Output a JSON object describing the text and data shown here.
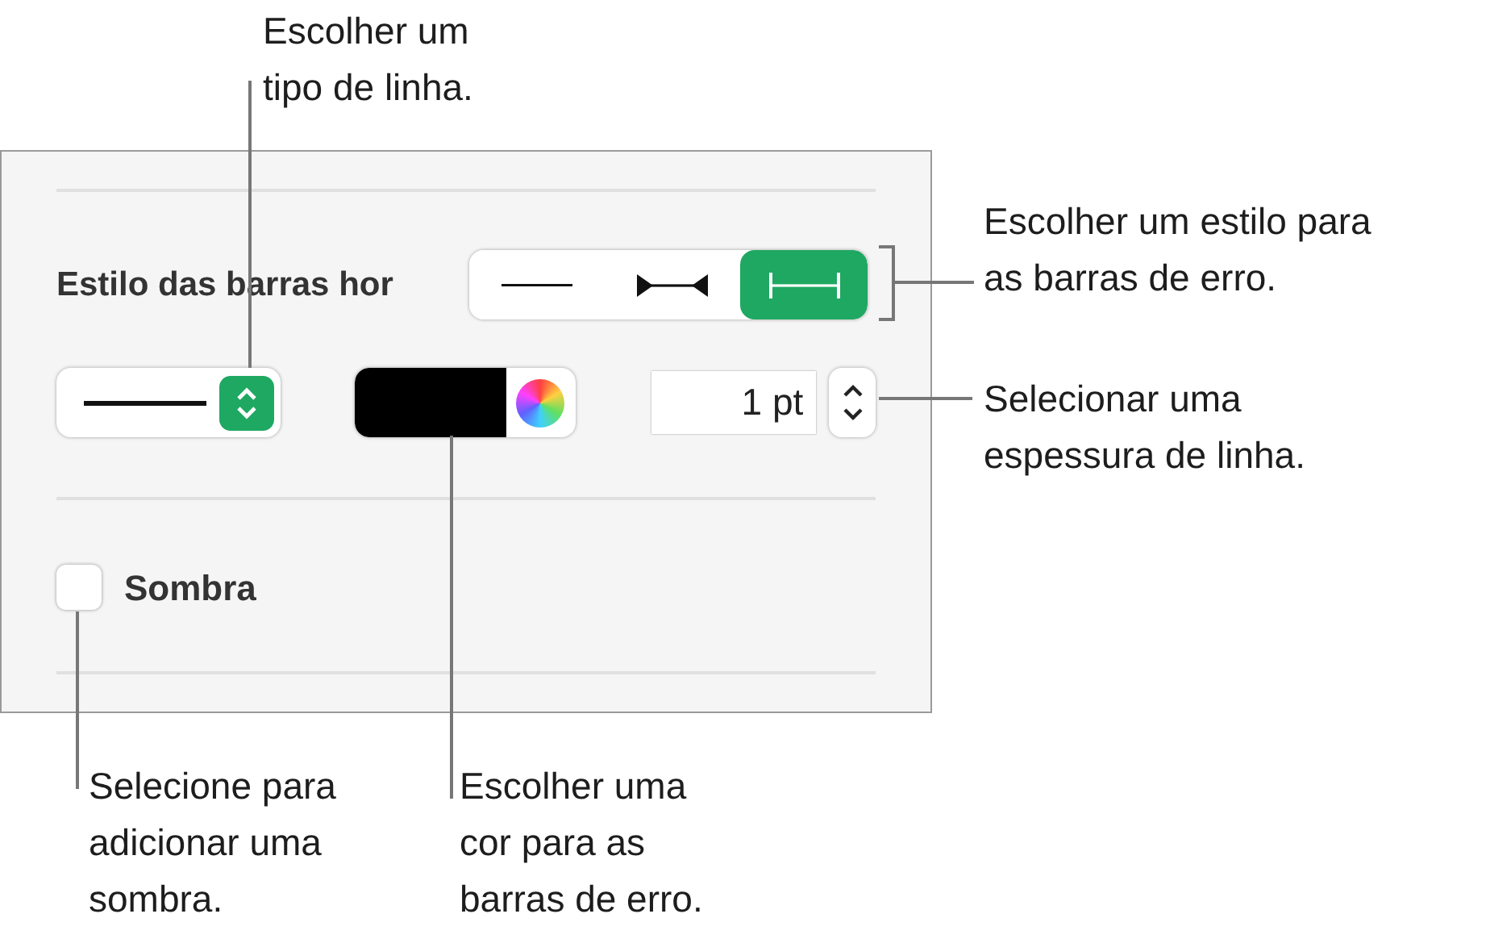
{
  "panel": {
    "style_label": "Estilo das barras hor",
    "segments": [
      {
        "kind": "plain",
        "selected": false
      },
      {
        "kind": "arrows",
        "selected": false
      },
      {
        "kind": "caps",
        "selected": true
      }
    ],
    "line_value": "1 pt",
    "shadow": {
      "label": "Sombra",
      "checked": false
    }
  },
  "callouts": [
    {
      "lines": [
        "Escolher um",
        "tipo de linha."
      ]
    },
    {
      "lines": [
        "Escolher um estilo para",
        "as barras de erro."
      ]
    },
    {
      "lines": [
        "Selecionar uma",
        "espessura de linha."
      ]
    },
    {
      "lines": [
        "Selecione para",
        "adicionar uma",
        "sombra."
      ]
    },
    {
      "lines": [
        "Escolher uma",
        "cor para as",
        "barras de erro."
      ]
    }
  ]
}
